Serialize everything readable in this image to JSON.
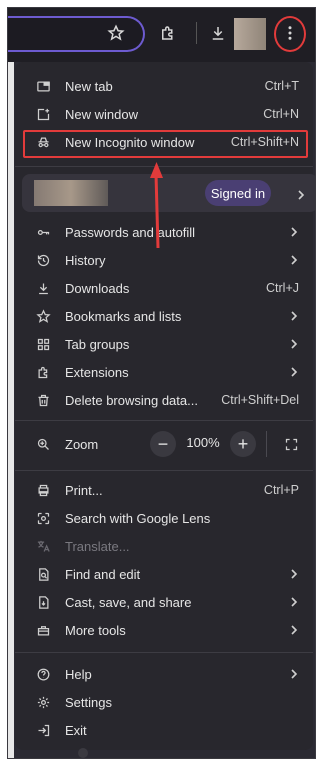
{
  "toolbar": {
    "icons": [
      "bookmark-star-icon",
      "extensions-puzzle-icon",
      "download-icon",
      "avatar",
      "more-vert-icon"
    ]
  },
  "menu": {
    "top_items": [
      {
        "label": "New tab",
        "shortcut": "Ctrl+T",
        "icon": "new-tab-icon"
      },
      {
        "label": "New window",
        "shortcut": "Ctrl+N",
        "icon": "new-window-icon"
      },
      {
        "label": "New Incognito window",
        "shortcut": "Ctrl+Shift+N",
        "icon": "incognito-icon"
      }
    ],
    "profile": {
      "status": "Signed in"
    },
    "items2": [
      {
        "label": "Passwords and autofill",
        "icon": "key-icon",
        "submenu": true
      },
      {
        "label": "History",
        "icon": "history-icon",
        "submenu": true
      },
      {
        "label": "Downloads",
        "shortcut": "Ctrl+J",
        "icon": "download-icon"
      },
      {
        "label": "Bookmarks and lists",
        "icon": "star-icon",
        "submenu": true
      },
      {
        "label": "Tab groups",
        "icon": "tab-groups-icon",
        "submenu": true
      },
      {
        "label": "Extensions",
        "icon": "extensions-icon",
        "submenu": true
      },
      {
        "label": "Delete browsing data...",
        "shortcut": "Ctrl+Shift+Del",
        "icon": "trash-icon"
      }
    ],
    "zoom": {
      "label": "Zoom",
      "minus": "−",
      "value": "100%",
      "plus": "+"
    },
    "items3": [
      {
        "label": "Print...",
        "shortcut": "Ctrl+P",
        "icon": "print-icon"
      },
      {
        "label": "Search with Google Lens",
        "icon": "lens-icon"
      },
      {
        "label": "Translate...",
        "icon": "translate-icon",
        "disabled": true
      },
      {
        "label": "Find and edit",
        "icon": "find-icon",
        "submenu": true
      },
      {
        "label": "Cast, save, and share",
        "icon": "cast-save-icon",
        "submenu": true
      },
      {
        "label": "More tools",
        "icon": "toolbox-icon",
        "submenu": true
      }
    ],
    "items4": [
      {
        "label": "Help",
        "icon": "help-icon",
        "submenu": true
      },
      {
        "label": "Settings",
        "icon": "settings-icon"
      },
      {
        "label": "Exit",
        "icon": "exit-icon"
      }
    ]
  },
  "colors": {
    "menu_bg": "#28272d",
    "annotation_red": "#e23b3b",
    "signed_in_pill": "#4a3f73"
  }
}
